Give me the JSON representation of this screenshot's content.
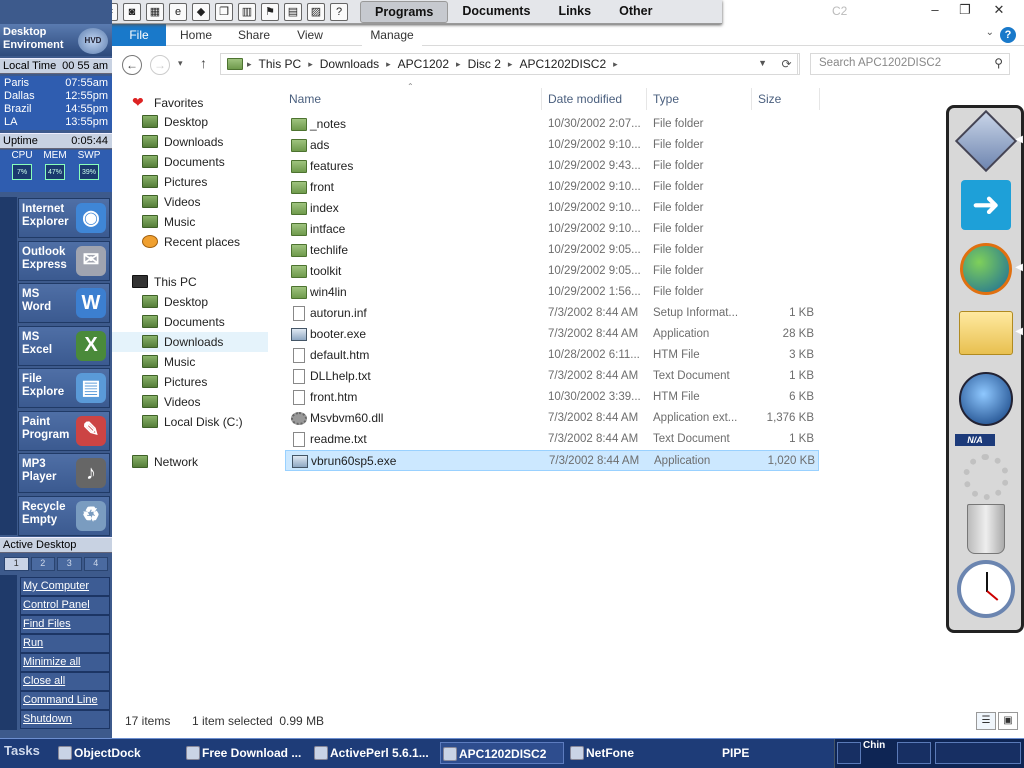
{
  "left_panel": {
    "title": "Desktop Enviroment",
    "logo": "HVD",
    "local_time_label": "Local Time",
    "local_time_value": "00 55 am",
    "cities": [
      {
        "city": "Paris",
        "time": "07:55am"
      },
      {
        "city": "Dallas",
        "time": "12:55pm"
      },
      {
        "city": "Brazil",
        "time": "14:55pm"
      },
      {
        "city": "LA",
        "time": "13:55pm"
      }
    ],
    "uptime_label": "Uptime",
    "uptime_value": "0:05:44",
    "meters": [
      {
        "label": "CPU",
        "value": "7%"
      },
      {
        "label": "MEM",
        "value": "47%"
      },
      {
        "label": "SWP",
        "value": "39%"
      }
    ],
    "apps": [
      {
        "label1": "Internet",
        "label2": "Explorer",
        "icon": "globe-icon"
      },
      {
        "label1": "Outlook",
        "label2": "Express",
        "icon": "mail-icon"
      },
      {
        "label1": "MS",
        "label2": "Word",
        "icon": "word-icon"
      },
      {
        "label1": "MS",
        "label2": "Excel",
        "icon": "excel-icon"
      },
      {
        "label1": "File",
        "label2": "Explore",
        "icon": "file-explorer-icon"
      },
      {
        "label1": "Paint",
        "label2": "Program",
        "icon": "paint-icon"
      },
      {
        "label1": "MP3",
        "label2": "Player",
        "icon": "speaker-icon"
      },
      {
        "label1": "Recycle",
        "label2": "Empty",
        "icon": "recycle-bin-icon"
      }
    ],
    "active_desktop_label": "Active Desktop",
    "desktop_tabs": [
      "1",
      "2",
      "3",
      "4"
    ],
    "menu": [
      "My Computer",
      "Control Panel",
      "Find Files",
      "Run",
      "Minimize all",
      "Close all",
      "Command Line",
      "Shutdown"
    ]
  },
  "top_toolbar": {
    "tabs": [
      "Programs",
      "Documents",
      "Links",
      "Other"
    ],
    "active_tab": "Programs",
    "icons": [
      "paint-icon",
      "pencil-icon",
      "plus-icon",
      "tool-icon",
      "crop-icon",
      "camera-icon",
      "scanner-icon",
      "ie-icon",
      "diamond-icon",
      "copy-icon",
      "book-icon",
      "door-icon",
      "panel-icon",
      "book2-icon",
      "help-icon"
    ]
  },
  "window": {
    "ghost_title": "C2",
    "controls": [
      "–",
      "❐",
      "✕"
    ]
  },
  "ribbon": {
    "tabs": [
      "File",
      "Home",
      "Share",
      "View",
      "Manage"
    ]
  },
  "address": {
    "segments": [
      "This PC",
      "Downloads",
      "APC1202",
      "Disc 2",
      "APC1202DISC2"
    ],
    "search_placeholder": "Search APC1202DISC2"
  },
  "nav": {
    "favorites_label": "Favorites",
    "favorites": [
      "Desktop",
      "Downloads",
      "Documents",
      "Pictures",
      "Videos",
      "Music",
      "Recent places"
    ],
    "thispc_label": "This PC",
    "thispc": [
      "Desktop",
      "Documents",
      "Downloads",
      "Music",
      "Pictures",
      "Videos",
      "Local Disk (C:)"
    ],
    "network_label": "Network",
    "selected": "Downloads"
  },
  "columns": {
    "name": "Name",
    "date": "Date modified",
    "type": "Type",
    "size": "Size"
  },
  "files": [
    {
      "name": "_notes",
      "date": "10/30/2002 2:07...",
      "type": "File folder",
      "size": "",
      "kind": "folder"
    },
    {
      "name": "ads",
      "date": "10/29/2002 9:10...",
      "type": "File folder",
      "size": "",
      "kind": "folder"
    },
    {
      "name": "features",
      "date": "10/29/2002 9:43...",
      "type": "File folder",
      "size": "",
      "kind": "folder"
    },
    {
      "name": "front",
      "date": "10/29/2002 9:10...",
      "type": "File folder",
      "size": "",
      "kind": "folder"
    },
    {
      "name": "index",
      "date": "10/29/2002 9:10...",
      "type": "File folder",
      "size": "",
      "kind": "folder"
    },
    {
      "name": "intface",
      "date": "10/29/2002 9:10...",
      "type": "File folder",
      "size": "",
      "kind": "folder"
    },
    {
      "name": "techlife",
      "date": "10/29/2002 9:05...",
      "type": "File folder",
      "size": "",
      "kind": "folder"
    },
    {
      "name": "toolkit",
      "date": "10/29/2002 9:05...",
      "type": "File folder",
      "size": "",
      "kind": "folder"
    },
    {
      "name": "win4lin",
      "date": "10/29/2002 1:56...",
      "type": "File folder",
      "size": "",
      "kind": "folder"
    },
    {
      "name": "autorun.inf",
      "date": "7/3/2002 8:44 AM",
      "type": "Setup Informat...",
      "size": "1 KB",
      "kind": "setup"
    },
    {
      "name": "booter.exe",
      "date": "7/3/2002 8:44 AM",
      "type": "Application",
      "size": "28 KB",
      "kind": "exe"
    },
    {
      "name": "default.htm",
      "date": "10/28/2002 6:11...",
      "type": "HTM File",
      "size": "3 KB",
      "kind": "doc"
    },
    {
      "name": "DLLhelp.txt",
      "date": "7/3/2002 8:44 AM",
      "type": "Text Document",
      "size": "1 KB",
      "kind": "doc"
    },
    {
      "name": "front.htm",
      "date": "10/30/2002 3:39...",
      "type": "HTM File",
      "size": "6 KB",
      "kind": "doc"
    },
    {
      "name": "Msvbvm60.dll",
      "date": "7/3/2002 8:44 AM",
      "type": "Application ext...",
      "size": "1,376 KB",
      "kind": "dll"
    },
    {
      "name": "readme.txt",
      "date": "7/3/2002 8:44 AM",
      "type": "Text Document",
      "size": "1 KB",
      "kind": "doc"
    },
    {
      "name": "vbrun60sp5.exe",
      "date": "7/3/2002 8:44 AM",
      "type": "Application",
      "size": "1,020 KB",
      "kind": "exe"
    }
  ],
  "selected_file": "vbrun60sp5.exe",
  "status": {
    "items": "17 items",
    "selected": "1 item selected  0.99 MB"
  },
  "dock": {
    "items": [
      "settings-diamond-icon",
      "login-arrow-icon",
      "globe-icon",
      "folder-icon",
      "windows-orb-icon",
      "recycle-bin-icon",
      "clock-icon"
    ],
    "na_label": "N/A"
  },
  "taskbar": {
    "tasks_label": "Tasks",
    "items": [
      "ObjectDock",
      "Free Download ...",
      "ActivePerl 5.6.1...",
      "APC1202DISC2",
      "NetFone",
      "PIPE"
    ],
    "active": "APC1202DISC2",
    "tray_label": "Chin"
  }
}
